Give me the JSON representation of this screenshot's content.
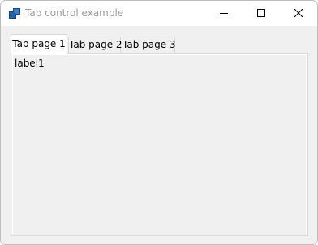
{
  "window": {
    "title": "Tab control example",
    "icon": "app-window-icon",
    "controls": {
      "minimize": "minimize-icon",
      "maximize": "maximize-icon",
      "close": "close-icon"
    }
  },
  "tabs": [
    {
      "label": "Tab page 1",
      "selected": true
    },
    {
      "label": "Tab page 2",
      "selected": false
    },
    {
      "label": "Tab page 3",
      "selected": false
    }
  ],
  "panel": {
    "label": "label1"
  },
  "colors": {
    "titlebar": "#ffffff",
    "title_text": "#9a9a9a",
    "client": "#f0f0f0",
    "tab_border": "#d9d9d9",
    "icon_blue": "#0a4a8a"
  }
}
